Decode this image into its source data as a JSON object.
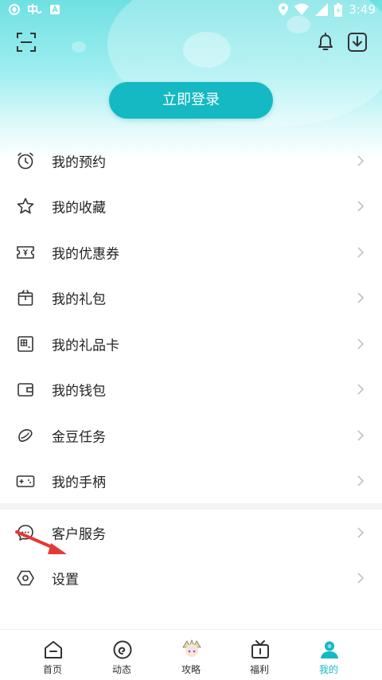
{
  "status_bar": {
    "time": "3:49"
  },
  "header": {
    "login_label": "立即登录"
  },
  "menu": {
    "items": [
      {
        "label": "我的预约",
        "icon": "alarm-clock-icon"
      },
      {
        "label": "我的收藏",
        "icon": "star-icon"
      },
      {
        "label": "我的优惠券",
        "icon": "coupon-icon"
      },
      {
        "label": "我的礼包",
        "icon": "gift-box-icon"
      },
      {
        "label": "我的礼品卡",
        "icon": "gift-card-icon"
      },
      {
        "label": "我的钱包",
        "icon": "wallet-icon"
      },
      {
        "label": "金豆任务",
        "icon": "bean-icon"
      },
      {
        "label": "我的手柄",
        "icon": "gamepad-icon"
      }
    ],
    "secondary": [
      {
        "label": "客户服务",
        "icon": "chat-icon"
      },
      {
        "label": "设置",
        "icon": "settings-icon"
      }
    ]
  },
  "bottom_nav": {
    "items": [
      {
        "label": "首页",
        "icon": "home-icon"
      },
      {
        "label": "动态",
        "icon": "feed-icon"
      },
      {
        "label": "攻略",
        "icon": "guide-avatar-icon"
      },
      {
        "label": "福利",
        "icon": "gift-tv-icon"
      },
      {
        "label": "我的",
        "icon": "profile-icon",
        "active": true
      }
    ]
  },
  "colors": {
    "accent": "#14b9c3",
    "header_top": "#6fe0e2",
    "text": "#222222",
    "annotation": "#e53935"
  }
}
